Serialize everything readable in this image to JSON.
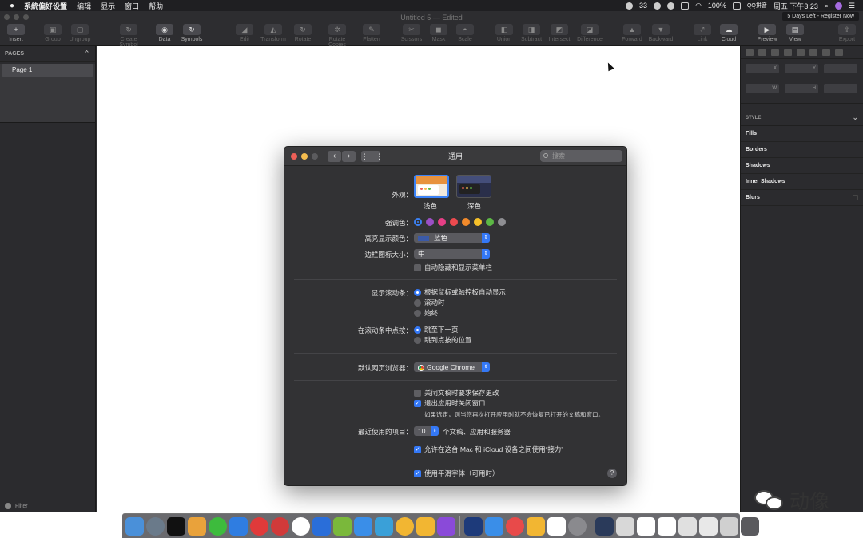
{
  "menubar": {
    "apple": "",
    "items": [
      "系統偏好设置",
      "编辑",
      "显示",
      "窗口",
      "帮助"
    ],
    "status_badge": "33",
    "battery": "100%",
    "ime": "QQ拼音",
    "clock": "周五 下午3:23"
  },
  "sketch": {
    "window_title": "Untitled 5 — Edited",
    "trial": "5 Days Left - Register Now",
    "toolbar": [
      {
        "label": "Insert",
        "icon": "+"
      },
      {
        "label": "Group",
        "icon": "▣"
      },
      {
        "label": "Ungroup",
        "icon": "▢"
      },
      {
        "label": "Create Symbol",
        "icon": "↻"
      },
      {
        "label": "Data",
        "icon": "◉"
      },
      {
        "label": "Symbols",
        "icon": "↻"
      },
      {
        "label": "Edit",
        "icon": "◢"
      },
      {
        "label": "Transform",
        "icon": "◭"
      },
      {
        "label": "Rotate",
        "icon": "↻"
      },
      {
        "label": "Rotate Copies",
        "icon": "✲"
      },
      {
        "label": "Flatten",
        "icon": "✎"
      },
      {
        "label": "Scissors",
        "icon": "✂"
      },
      {
        "label": "Mask",
        "icon": "◼"
      },
      {
        "label": "Scale",
        "icon": "◓"
      },
      {
        "label": "Union",
        "icon": "◧"
      },
      {
        "label": "Subtract",
        "icon": "◨"
      },
      {
        "label": "Intersect",
        "icon": "◩"
      },
      {
        "label": "Difference",
        "icon": "◪"
      },
      {
        "label": "Forward",
        "icon": "▲"
      },
      {
        "label": "Backward",
        "icon": "▼"
      },
      {
        "label": "Link",
        "icon": "⤤"
      },
      {
        "label": "Cloud",
        "icon": "☁"
      },
      {
        "label": "Preview",
        "icon": "▶"
      },
      {
        "label": "View",
        "icon": "▤"
      },
      {
        "label": "Export",
        "icon": "⇪"
      }
    ],
    "pages_header": "PAGES",
    "page_add": "+",
    "pages": [
      "Page 1"
    ],
    "filter": "Filter",
    "inspector": {
      "fields": [
        "X",
        "Y",
        "",
        "W",
        "H",
        ""
      ],
      "style_header": "STYLE",
      "sections": [
        "Fills",
        "Borders",
        "Shadows",
        "Inner Shadows",
        "Blurs"
      ]
    }
  },
  "prefs": {
    "title": "通用",
    "search_placeholder": "搜索",
    "appearance_label": "外观：",
    "appearance_light": "浅色",
    "appearance_dark": "深色",
    "accent_label": "强调色：",
    "accent_colors": [
      "#3b82f6",
      "#9b4fc5",
      "#e63f86",
      "#ec4a4f",
      "#f28a2b",
      "#f5c02a",
      "#5cb845",
      "#8e8e92"
    ],
    "highlight_label": "高亮显示颜色：",
    "highlight_value": "蓝色",
    "sidebar_icon_label": "边栏图标大小：",
    "sidebar_icon_value": "中",
    "auto_hide_menubar": "自动隐藏和显示菜单栏",
    "scrollbar_label": "显示滚动条：",
    "scrollbar_options": [
      "根据鼠标或触控板自动显示",
      "滚动时",
      "始终"
    ],
    "scroll_click_label": "在滚动条中点按：",
    "scroll_click_options": [
      "跳至下一页",
      "跳到点按的位置"
    ],
    "browser_label": "默认网页浏览器：",
    "browser_value": "Google Chrome",
    "ask_keep_changes": "关闭文稿时要求保存更改",
    "close_windows": "退出应用时关闭窗口",
    "close_windows_note": "如果选定，则当您再次打开应用时就不会恢复已打开的文稿和窗口。",
    "recent_label": "最近使用的项目：",
    "recent_value": "10",
    "recent_suffix": "个文稿、应用和服务器",
    "handoff": "允许在这台 Mac 和 iCloud 设备之间使用“接力”",
    "font_smoothing": "使用平滑字体（可用时）",
    "help": "?"
  },
  "dock": {
    "colors": [
      "#4a90d9",
      "#6a7a8a",
      "#111111",
      "#e9a23b",
      "#3dbb3d",
      "#2f7de1",
      "#e03a3a",
      "#d13a3a",
      "#ffffff",
      "#2a6ed9",
      "#7ab83b",
      "#3a8ee8",
      "#3aa0d8",
      "#f2b632",
      "#f2b632",
      "#8a4ad9",
      "#1d3a7a",
      "#3a8ee8",
      "#e84a4a",
      "#f2b632",
      "#ffffff",
      "#8a8a8e",
      "#2a3a5a",
      "#d8d8d8",
      "#ffffff",
      "#ffffff",
      "#e0e0e0",
      "#e8e8e8",
      "#d0d0d0",
      "#5a5a5e"
    ]
  },
  "watermark": "动像"
}
